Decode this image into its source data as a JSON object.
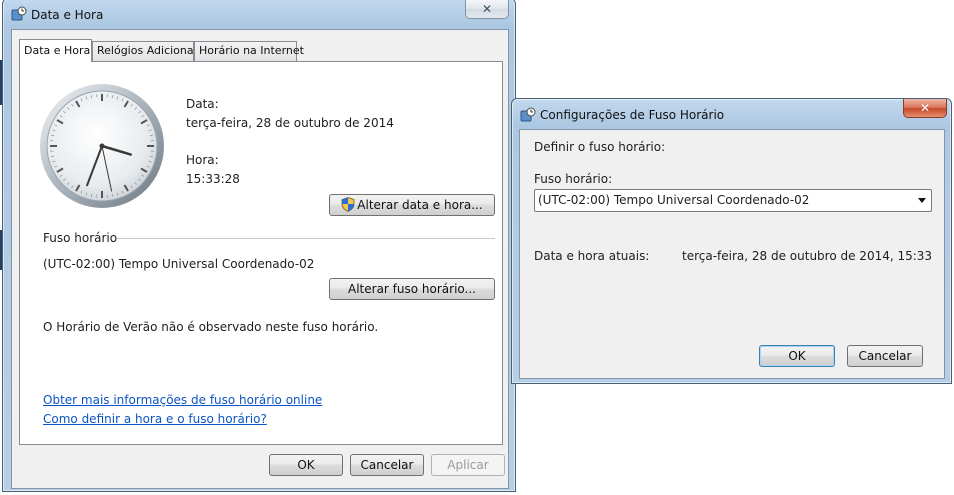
{
  "main_window": {
    "title": "Data e Hora",
    "tabs": [
      {
        "label": "Data e Hora",
        "active": true
      },
      {
        "label": "Relógios Adicionais",
        "active": false
      },
      {
        "label": "Horário na Internet",
        "active": false
      }
    ],
    "date_label": "Data:",
    "date_value": "terça-feira, 28 de outubro de 2014",
    "time_label": "Hora:",
    "time_value": "15:33:28",
    "change_datetime_button": "Alterar data e hora...",
    "timezone_section_label": "Fuso horário",
    "timezone_value": "(UTC-02:00) Tempo Universal Coordenado-02",
    "change_timezone_button": "Alterar fuso horário...",
    "dst_note": "O Horário de Verão não é observado neste fuso horário.",
    "link_more_info": "Obter mais informações de fuso horário online",
    "link_how_to": "Como definir a hora e o fuso horário?",
    "ok_button": "OK",
    "cancel_button": "Cancelar",
    "apply_button": "Aplicar",
    "clock": {
      "hour": 15,
      "minute": 33,
      "second": 28
    }
  },
  "tz_dialog": {
    "title": "Configurações de Fuso Horário",
    "heading": "Definir o fuso horário:",
    "timezone_label": "Fuso horário:",
    "timezone_selected": "(UTC-02:00) Tempo Universal Coordenado-02",
    "current_label": "Data e hora atuais:",
    "current_value": "terça-feira, 28 de outubro de 2014, 15:33",
    "ok_button": "OK",
    "cancel_button": "Cancelar"
  },
  "icons": {
    "window_icon": "clock-globe-icon",
    "close": "close-icon",
    "uac_shield": "uac-shield-icon",
    "dropdown": "chevron-down-icon"
  },
  "colors": {
    "frame": "#b7cfe6",
    "close_red": "#c74a2b",
    "link": "#0b54c3",
    "client": "#f0f0f0"
  }
}
